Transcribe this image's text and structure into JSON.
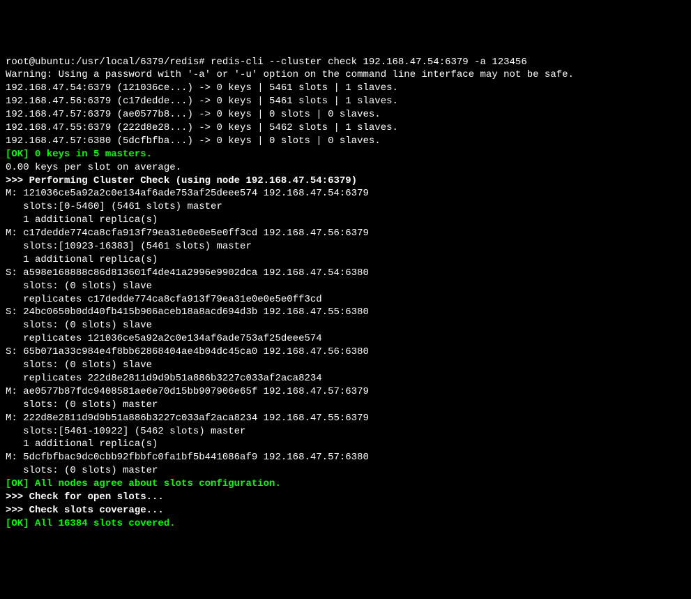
{
  "prompt": "root@ubuntu:/usr/local/6379/redis# redis-cli --cluster check 192.168.47.54:6379 -a 123456",
  "warning": "Warning: Using a password with '-a' or '-u' option on the command line interface may not be safe.",
  "node_lines": [
    "192.168.47.54:6379 (121036ce...) -> 0 keys | 5461 slots | 1 slaves.",
    "192.168.47.56:6379 (c17dedde...) -> 0 keys | 5461 slots | 1 slaves.",
    "192.168.47.57:6379 (ae0577b8...) -> 0 keys | 0 slots | 0 slaves.",
    "192.168.47.55:6379 (222d8e28...) -> 0 keys | 5462 slots | 1 slaves.",
    "192.168.47.57:6380 (5dcfbfba...) -> 0 keys | 0 slots | 0 slaves."
  ],
  "ok_keys": "[OK] 0 keys in 5 masters.",
  "avg_keys": "0.00 keys per slot on average.",
  "header_check": ">>> Performing Cluster Check (using node 192.168.47.54:6379)",
  "cluster_lines": [
    "M: 121036ce5a92a2c0e134af6ade753af25deee574 192.168.47.54:6379",
    "   slots:[0-5460] (5461 slots) master",
    "   1 additional replica(s)",
    "M: c17dedde774ca8cfa913f79ea31e0e0e5e0ff3cd 192.168.47.56:6379",
    "   slots:[10923-16383] (5461 slots) master",
    "   1 additional replica(s)",
    "S: a598e168888c86d813601f4de41a2996e9902dca 192.168.47.54:6380",
    "   slots: (0 slots) slave",
    "   replicates c17dedde774ca8cfa913f79ea31e0e0e5e0ff3cd",
    "S: 24bc0650b0dd40fb415b906aceb18a8acd694d3b 192.168.47.55:6380",
    "   slots: (0 slots) slave",
    "   replicates 121036ce5a92a2c0e134af6ade753af25deee574",
    "S: 65b071a33c984e4f8bb62868404ae4b04dc45ca0 192.168.47.56:6380",
    "   slots: (0 slots) slave",
    "   replicates 222d8e2811d9d9b51a886b3227c033af2aca8234",
    "M: ae0577b87fdc9408581ae6e70d15bb907906e65f 192.168.47.57:6379",
    "   slots: (0 slots) master",
    "M: 222d8e2811d9d9b51a886b3227c033af2aca8234 192.168.47.55:6379",
    "   slots:[5461-10922] (5462 slots) master",
    "   1 additional replica(s)",
    "M: 5dcfbfbac9dc0cbb92fbbfc0fa1bf5b441086af9 192.168.47.57:6380",
    "   slots: (0 slots) master"
  ],
  "ok_config": "[OK] All nodes agree about slots configuration.",
  "check_open": ">>> Check for open slots...",
  "check_coverage": ">>> Check slots coverage...",
  "ok_covered": "[OK] All 16384 slots covered."
}
